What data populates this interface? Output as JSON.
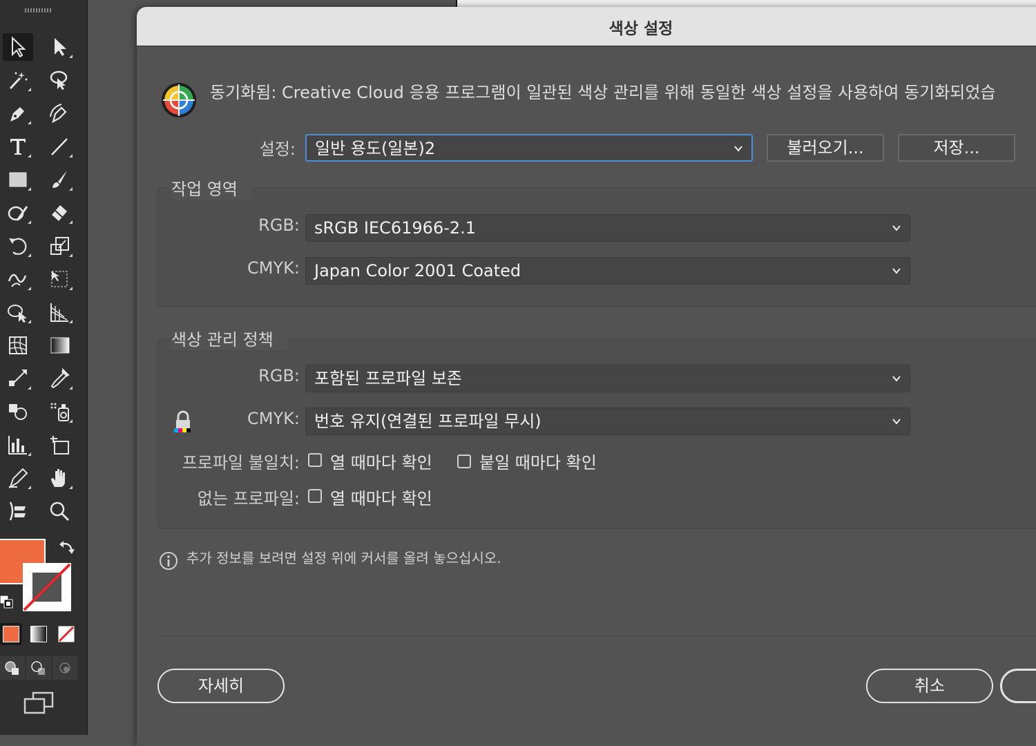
{
  "dialog": {
    "title": "색상 설정",
    "sync_message": "동기화됨: Creative Cloud 응용 프로그램이 일관된 색상 관리를 위해 동일한 색상 설정을 사용하여 동기화되었습",
    "settings_label": "설정:",
    "settings_value": "일반 용도(일본)2",
    "load_button": "불러오기...",
    "save_button": "저장...",
    "working_spaces": {
      "title": "작업 영역",
      "rgb_label": "RGB:",
      "rgb_value": "sRGB IEC61966-2.1",
      "cmyk_label": "CMYK:",
      "cmyk_value": "Japan Color 2001 Coated"
    },
    "policies": {
      "title": "색상 관리 정책",
      "rgb_label": "RGB:",
      "rgb_value": "포함된 프로파일 보존",
      "cmyk_label": "CMYK:",
      "cmyk_value": "번호 유지(연결된 프로파일 무시)",
      "mismatch_label": "프로파일 불일치:",
      "mismatch_open": "열 때마다 확인",
      "mismatch_paste": "붙일 때마다 확인",
      "missing_label": "없는 프로파일:",
      "missing_open": "열 때마다 확인"
    },
    "info_text": "추가 정보를 보려면 설정 위에 커서를 올려 놓으십시오.",
    "more_button": "자세히",
    "cancel_button": "취소"
  },
  "toolbar": {
    "fill_color": "#ee6a3f",
    "stroke": "none"
  }
}
